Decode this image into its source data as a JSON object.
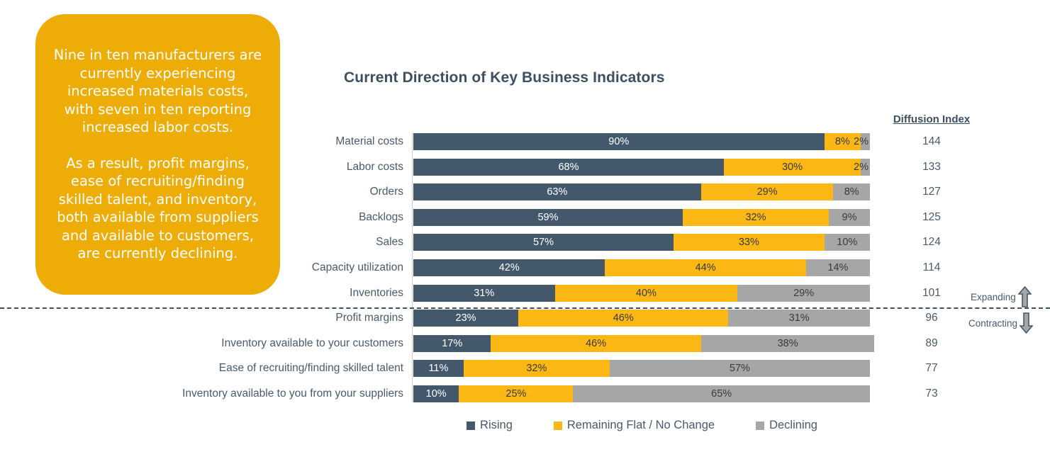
{
  "callout": {
    "paragraph_1": "Nine in ten manufacturers are currently experiencing increased materials costs, with seven in ten reporting increased labor costs.",
    "paragraph_2": "As a result, profit margins, ease of recruiting/finding skilled talent, and inventory, both available from suppliers and available to customers, are currently declining.",
    "background_color": "#EDAD06"
  },
  "diffusion_header": "Diffusion Index",
  "direction_notes": {
    "expanding": "Expanding",
    "contracting": "Contracting",
    "up_icon": "up-arrow-icon",
    "down_icon": "down-arrow-icon"
  },
  "chart_data": {
    "type": "bar",
    "orientation": "horizontal",
    "stacked": true,
    "stack_total": 100,
    "title": "Current Direction of Key Business Indicators",
    "xlabel": "",
    "ylabel": "",
    "xlim": [
      0,
      100
    ],
    "grid": false,
    "legend_position": "bottom",
    "value_suffix": "%",
    "categories": [
      "Material costs",
      "Labor costs",
      "Orders",
      "Backlogs",
      "Sales",
      "Capacity utilization",
      "Inventories",
      "Profit margins",
      "Inventory available to your customers",
      "Ease of recruiting/finding skilled talent",
      "Inventory available to you from your suppliers"
    ],
    "series": [
      {
        "name": "Rising",
        "color": "#44586B",
        "values": [
          90,
          68,
          63,
          59,
          57,
          42,
          31,
          23,
          17,
          11,
          10
        ],
        "labels": [
          "90%",
          "68%",
          "63%",
          "59%",
          "57%",
          "42%",
          "31%",
          "23%",
          "17%",
          "11%",
          "10%"
        ]
      },
      {
        "name": "Remaining Flat / No Change",
        "color": "#FBB714",
        "values": [
          8,
          30,
          29,
          32,
          33,
          44,
          40,
          46,
          46,
          32,
          25
        ],
        "labels": [
          "8%",
          "30%",
          "29%",
          "32%",
          "33%",
          "44%",
          "40%",
          "46%",
          "46%",
          "32%",
          "25%"
        ]
      },
      {
        "name": "Declining",
        "color": "#A6A6A6",
        "values": [
          2,
          2,
          8,
          9,
          10,
          14,
          29,
          31,
          38,
          57,
          65
        ],
        "labels": [
          "2%",
          "2%",
          "8%",
          "9%",
          "10%",
          "14%",
          "29%",
          "31%",
          "38%",
          "57%",
          "65%"
        ]
      }
    ],
    "annotation_column": {
      "header": "Diffusion Index",
      "values": [
        144,
        133,
        127,
        125,
        124,
        114,
        101,
        96,
        89,
        77,
        73
      ]
    },
    "threshold_divider": {
      "after_category_index": 6,
      "style": "dashed",
      "color": "#3c4f63"
    }
  }
}
